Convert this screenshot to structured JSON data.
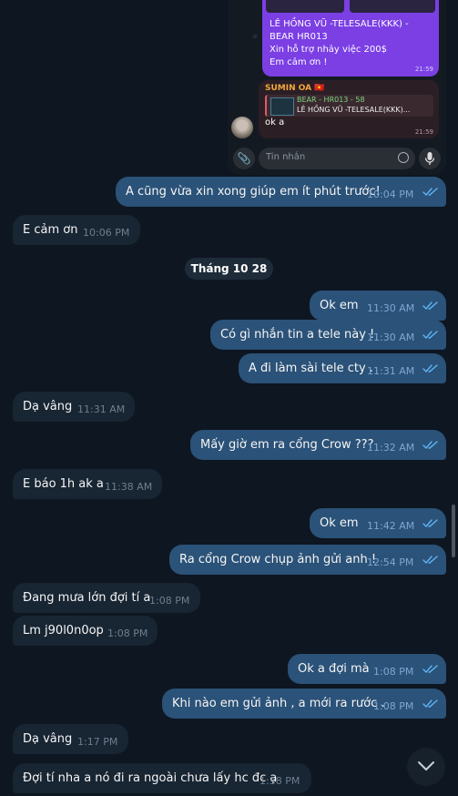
{
  "embedded_screenshot": {
    "purple_message": {
      "line1": "LÊ HỒNG VŨ -TELESALE(KKK) -",
      "line2": "BEAR HR013",
      "line3": "Xin hỗ trợ nhảy việc 200$",
      "line4": "Em cảm ơn !",
      "time": "21:59"
    },
    "quoted_message": {
      "sender": "SUMIN OA 🇻🇳",
      "reply_title": "BEAR - HR013 - 58",
      "reply_text": "LÊ HỒNG VŨ -TELESALE(KKK)...",
      "text": "ok a",
      "time": "21:59"
    },
    "input_placeholder": "Tin nhắn"
  },
  "date_divider": "Tháng 10 28",
  "messages": [
    {
      "dir": "out",
      "text": "A cũng vừa xin xong giúp em ít phút trước!",
      "time": "10:04 PM"
    },
    {
      "dir": "in",
      "text": "E cảm ơn",
      "time": "10:06 PM"
    },
    {
      "dir": "out",
      "text": "Ok em",
      "time": "11:30 AM"
    },
    {
      "dir": "out",
      "text": "Có gì nhắn tin a tele này !",
      "time": "11:30 AM"
    },
    {
      "dir": "out",
      "text": "A đi làm sài tele cty .",
      "time": "11:31 AM"
    },
    {
      "dir": "in",
      "text": "Dạ vâng",
      "time": "11:31 AM"
    },
    {
      "dir": "out",
      "text": "Mấy giờ em ra cổng Crow ???",
      "time": "11:32 AM"
    },
    {
      "dir": "in",
      "text": "E báo 1h ak a",
      "time": "11:38 AM"
    },
    {
      "dir": "out",
      "text": "Ok em",
      "time": "11:42 AM"
    },
    {
      "dir": "out",
      "text": "Ra cổng Crow chụp ảnh gửi anh !",
      "time": "12:54 PM"
    },
    {
      "dir": "in",
      "text": "Đang mưa lớn đợi tí a",
      "time": "1:08 PM"
    },
    {
      "dir": "in",
      "text": "Lm j90l0n0op",
      "time": "1:08 PM"
    },
    {
      "dir": "out",
      "text": "Ok a đợi mà",
      "time": "1:08 PM"
    },
    {
      "dir": "out",
      "text": "Khi nào em gửi ảnh , a mới ra rước .",
      "time": "1:08 PM"
    },
    {
      "dir": "in",
      "text": "Dạ vâng",
      "time": "1:17 PM"
    },
    {
      "dir": "in",
      "text": "Đợi tí nha a nó đi ra ngoài chưa lấy hc đc ạ",
      "time": "1:38 PM"
    }
  ],
  "colors": {
    "background": "#0e1621",
    "outgoing_bubble": "#2b5278",
    "incoming_bubble": "#182533",
    "read_ticks": "#5eb5f7"
  }
}
